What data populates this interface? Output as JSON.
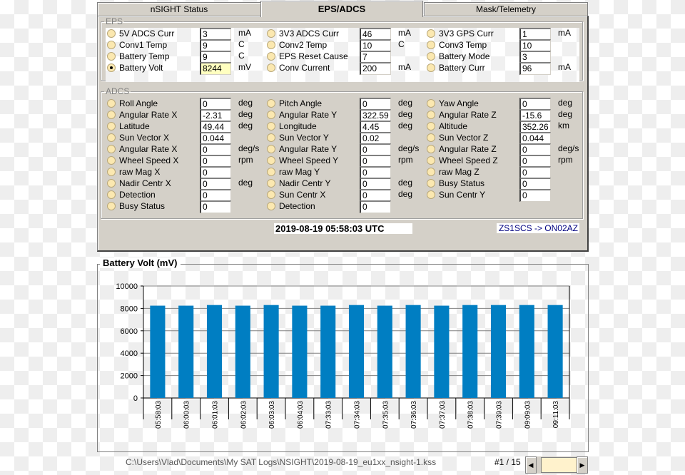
{
  "tabs": [
    "nSIGHT Status",
    "EPS/ADCS",
    "Mask/Telemetry"
  ],
  "active_tab": 1,
  "eps": {
    "legend": "EPS",
    "columns": [
      [
        {
          "label": "5V ADCS Curr",
          "value": "3",
          "unit": "mA",
          "checked": false
        },
        {
          "label": "Conv1 Temp",
          "value": "9",
          "unit": "C",
          "checked": false
        },
        {
          "label": "Battery Temp",
          "value": "9",
          "unit": "C",
          "checked": false
        },
        {
          "label": "Battery Volt",
          "value": "8244",
          "unit": "mV",
          "checked": true
        }
      ],
      [
        {
          "label": "3V3 ADCS Curr",
          "value": "46",
          "unit": "mA",
          "checked": false
        },
        {
          "label": "Conv2 Temp",
          "value": "10",
          "unit": "C",
          "checked": false
        },
        {
          "label": "EPS Reset Cause",
          "value": "7",
          "unit": "",
          "checked": false
        },
        {
          "label": "Conv Current",
          "value": "200",
          "unit": "mA",
          "checked": false
        }
      ],
      [
        {
          "label": "3V3 GPS Curr",
          "value": "1",
          "unit": "mA",
          "checked": false
        },
        {
          "label": "Conv3 Temp",
          "value": "10",
          "unit": "",
          "checked": false
        },
        {
          "label": "Battery Mode",
          "value": "3",
          "unit": "",
          "checked": false
        },
        {
          "label": "Battery Curr",
          "value": "96",
          "unit": "mA",
          "checked": false
        }
      ]
    ]
  },
  "adcs": {
    "legend": "ADCS",
    "columns": [
      [
        {
          "label": "Roll Angle",
          "value": "0",
          "unit": "deg"
        },
        {
          "label": "Angular Rate X",
          "value": "-2.31",
          "unit": "deg"
        },
        {
          "label": "Latitude",
          "value": "49.44",
          "unit": "deg"
        },
        {
          "label": "Sun Vector X",
          "value": "0.044",
          "unit": ""
        },
        {
          "label": "Angular Rate X",
          "value": "0",
          "unit": "deg/s"
        },
        {
          "label": "Wheel Speed X",
          "value": "0",
          "unit": "rpm"
        },
        {
          "label": "raw Mag X",
          "value": "0",
          "unit": ""
        },
        {
          "label": "Nadir Centr X",
          "value": "0",
          "unit": "deg"
        },
        {
          "label": "Detection",
          "value": "0",
          "unit": ""
        },
        {
          "label": "Busy Status",
          "value": "0",
          "unit": ""
        }
      ],
      [
        {
          "label": "Pitch Angle",
          "value": "0",
          "unit": "deg"
        },
        {
          "label": "Angular Rate Y",
          "value": "322.59",
          "unit": "deg"
        },
        {
          "label": "Longitude",
          "value": "4.45",
          "unit": "deg"
        },
        {
          "label": "Sun Vector Y",
          "value": "0.02",
          "unit": ""
        },
        {
          "label": "Angular Rate Y",
          "value": "0",
          "unit": "deg/s"
        },
        {
          "label": "Wheel Speed Y",
          "value": "0",
          "unit": "rpm"
        },
        {
          "label": "raw Mag Y",
          "value": "0",
          "unit": ""
        },
        {
          "label": "Nadir Centr Y",
          "value": "0",
          "unit": "deg"
        },
        {
          "label": "Sun Centr X",
          "value": "0",
          "unit": "deg"
        },
        {
          "label": "Detection",
          "value": "0",
          "unit": ""
        }
      ],
      [
        {
          "label": "Yaw Angle",
          "value": "0",
          "unit": "deg"
        },
        {
          "label": "Angular Rate Z",
          "value": "-15.6",
          "unit": "deg"
        },
        {
          "label": "Altitude",
          "value": "352.26",
          "unit": "km"
        },
        {
          "label": "Sun Vector Z",
          "value": "0.044",
          "unit": ""
        },
        {
          "label": "Angular Rate Z",
          "value": "0",
          "unit": "deg/s"
        },
        {
          "label": "Wheel Speed Z",
          "value": "0",
          "unit": "rpm"
        },
        {
          "label": "raw Mag Z",
          "value": "0",
          "unit": ""
        },
        {
          "label": "Busy Status",
          "value": "0",
          "unit": ""
        },
        {
          "label": "Sun Centr Y",
          "value": "0",
          "unit": ""
        }
      ]
    ]
  },
  "timestamp": "2019-08-19 05:58:03 UTC",
  "callsign": "ZS1SCS -> ON02AZ",
  "chart_data": {
    "type": "bar",
    "title": "Battery Volt (mV)",
    "xlabel": "",
    "ylabel": "",
    "ylim": [
      0,
      10000
    ],
    "yticks": [
      0,
      2000,
      4000,
      6000,
      8000,
      10000
    ],
    "grid": true,
    "color": "#007ec2",
    "categories": [
      "05:58:03",
      "06:00:03",
      "06:01:03",
      "06:02:03",
      "06:03:03",
      "06:04:03",
      "07:33:03",
      "07:34:03",
      "07:35:03",
      "07:36:03",
      "07:37:03",
      "07:38:03",
      "07:39:03",
      "09:09:03",
      "09:11:03"
    ],
    "values": [
      8244,
      8244,
      8300,
      8244,
      8300,
      8244,
      8244,
      8300,
      8244,
      8300,
      8244,
      8300,
      8300,
      8300,
      8300
    ]
  },
  "status": {
    "file_path": "C:\\Users\\Vlad\\Documents\\My SAT Logs\\NSIGHT\\2019-08-19_eu1xx_nsight-1.kss",
    "page_indicator": "#1 / 15",
    "scroll_left": "◀",
    "scroll_right": "▶"
  }
}
